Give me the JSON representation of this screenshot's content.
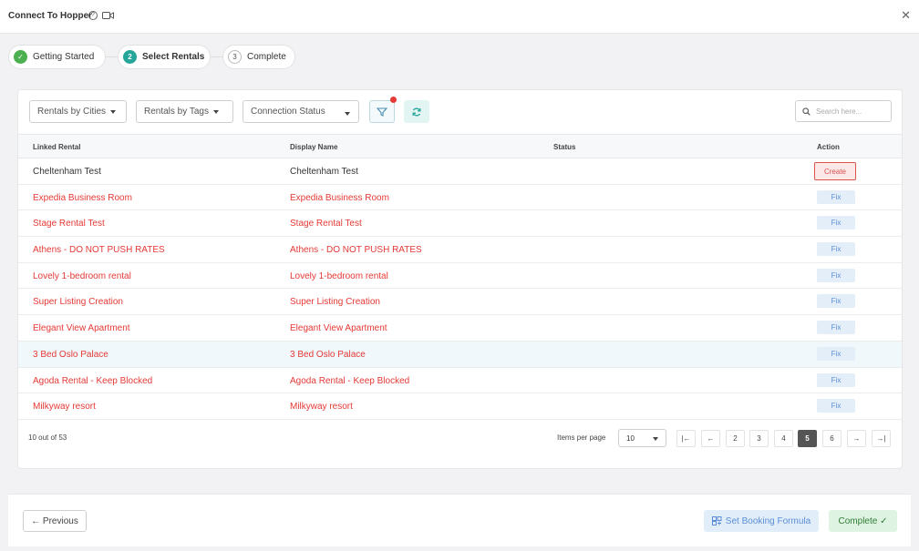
{
  "header": {
    "title": "Connect To Hopper",
    "help_glyph": "?",
    "close_glyph": "✕"
  },
  "steps": [
    {
      "label": "Getting Started",
      "num": "✓",
      "state": "done"
    },
    {
      "label": "Select Rentals",
      "num": "2",
      "state": "active"
    },
    {
      "label": "Complete",
      "num": "3",
      "state": "pending"
    }
  ],
  "filters": {
    "cities": "Rentals by Cities",
    "tags": "Rentals by Tags",
    "status": "Connection Status",
    "search_placeholder": "Search here..."
  },
  "table": {
    "headers": [
      "Linked Rental",
      "Display Name",
      "Status",
      "Action"
    ],
    "rows": [
      {
        "linked": "Cheltenham Test",
        "display": "Cheltenham Test",
        "status": "",
        "action": "Create",
        "color": "dark"
      },
      {
        "linked": "Expedia Business Room",
        "display": "Expedia Business Room",
        "status": "",
        "action": "Fix",
        "color": "red"
      },
      {
        "linked": "Stage Rental Test",
        "display": "Stage Rental Test",
        "status": "",
        "action": "Fix",
        "color": "red"
      },
      {
        "linked": "Athens - DO NOT PUSH RATES",
        "display": "Athens - DO NOT PUSH RATES",
        "status": "",
        "action": "Fix",
        "color": "red"
      },
      {
        "linked": "Lovely 1-bedroom rental",
        "display": "Lovely 1-bedroom rental",
        "status": "",
        "action": "Fix",
        "color": "red"
      },
      {
        "linked": "Super Listing Creation",
        "display": "Super Listing Creation",
        "status": "",
        "action": "Fix",
        "color": "red"
      },
      {
        "linked": "Elegant View Apartment",
        "display": "Elegant View Apartment",
        "status": "",
        "action": "Fix",
        "color": "red"
      },
      {
        "linked": "3 Bed Oslo Palace",
        "display": "3 Bed Oslo Palace",
        "status": "",
        "action": "Fix",
        "color": "red",
        "highlight": true
      },
      {
        "linked": "Agoda Rental - Keep Blocked",
        "display": "Agoda Rental - Keep Blocked",
        "status": "",
        "action": "Fix",
        "color": "red"
      },
      {
        "linked": "Milkyway resort",
        "display": "Milkyway resort",
        "status": "",
        "action": "Fix",
        "color": "red"
      }
    ]
  },
  "pagination": {
    "count_text": "10 out of 53",
    "items_per_page_label": "Items per page",
    "items_per_page_value": "10",
    "first": "|←",
    "prev": "←",
    "pages": [
      "2",
      "3",
      "4",
      "5",
      "6"
    ],
    "active_page": "5",
    "next": "→",
    "last": "→|"
  },
  "footer": {
    "previous": "← Previous",
    "set_formula": "Set Booking Formula",
    "complete": "Complete ✓"
  },
  "colors": {
    "accent_teal": "#26a69a",
    "error_red": "#e53935",
    "fix_blue": "#5b8ed6",
    "success_green": "#4caf50"
  }
}
